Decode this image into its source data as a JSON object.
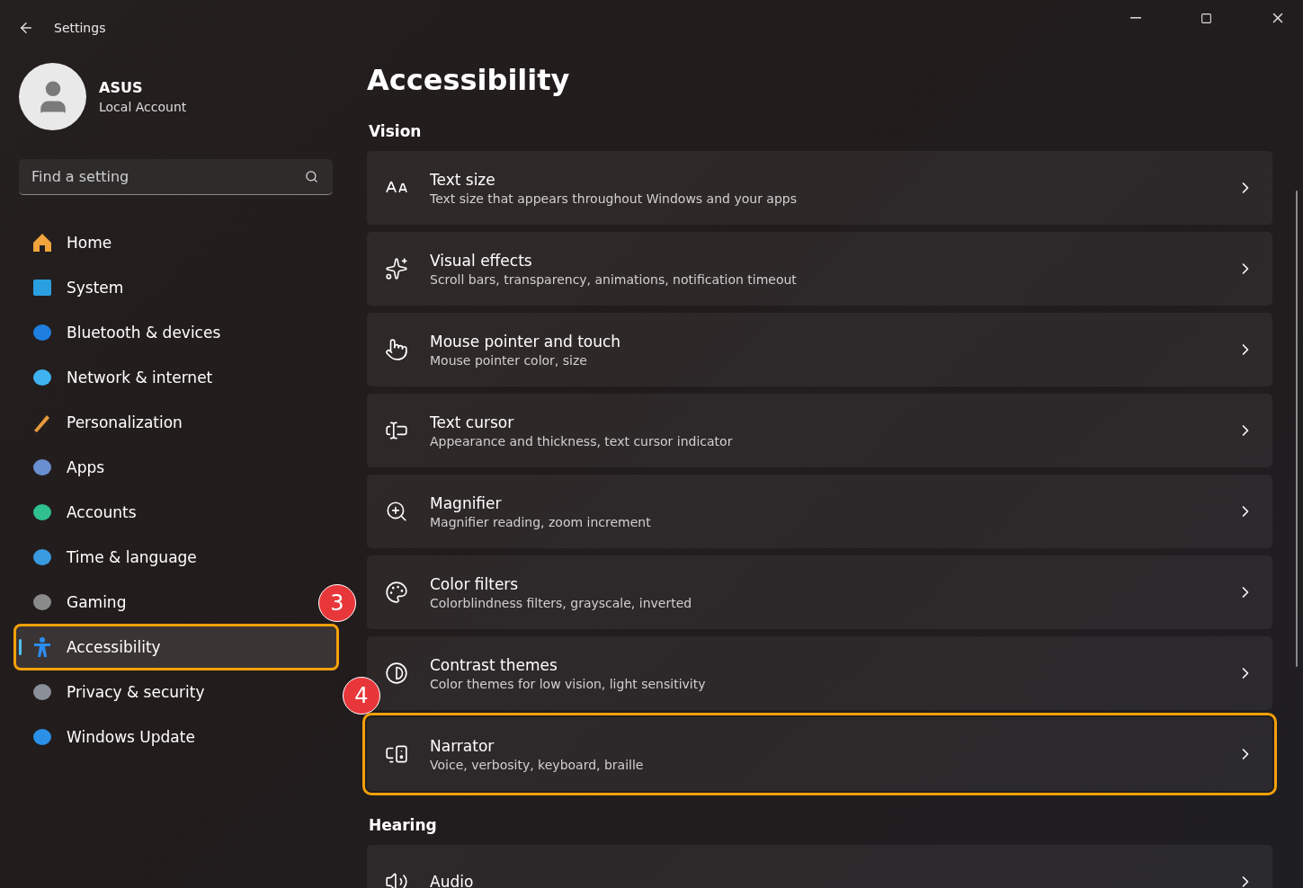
{
  "window": {
    "title": "Settings"
  },
  "account": {
    "name": "ASUS",
    "type": "Local Account"
  },
  "search": {
    "placeholder": "Find a setting"
  },
  "nav_items": [
    {
      "label": "Home",
      "selected": false
    },
    {
      "label": "System",
      "selected": false
    },
    {
      "label": "Bluetooth & devices",
      "selected": false
    },
    {
      "label": "Network & internet",
      "selected": false
    },
    {
      "label": "Personalization",
      "selected": false
    },
    {
      "label": "Apps",
      "selected": false
    },
    {
      "label": "Accounts",
      "selected": false
    },
    {
      "label": "Time & language",
      "selected": false
    },
    {
      "label": "Gaming",
      "selected": false
    },
    {
      "label": "Accessibility",
      "selected": true,
      "callout": "3"
    },
    {
      "label": "Privacy & security",
      "selected": false
    },
    {
      "label": "Windows Update",
      "selected": false
    }
  ],
  "page_title": "Accessibility",
  "sections": [
    {
      "title": "Vision",
      "items": [
        {
          "title": "Text size",
          "subtitle": "Text size that appears throughout Windows and your apps"
        },
        {
          "title": "Visual effects",
          "subtitle": "Scroll bars, transparency, animations, notification timeout"
        },
        {
          "title": "Mouse pointer and touch",
          "subtitle": "Mouse pointer color, size"
        },
        {
          "title": "Text cursor",
          "subtitle": "Appearance and thickness, text cursor indicator"
        },
        {
          "title": "Magnifier",
          "subtitle": "Magnifier reading, zoom increment"
        },
        {
          "title": "Color filters",
          "subtitle": "Colorblindness filters, grayscale, inverted"
        },
        {
          "title": "Contrast themes",
          "subtitle": "Color themes for low vision, light sensitivity"
        },
        {
          "title": "Narrator",
          "subtitle": "Voice, verbosity, keyboard, braille",
          "callout": "4"
        }
      ]
    },
    {
      "title": "Hearing",
      "items": [
        {
          "title": "Audio"
        }
      ]
    }
  ]
}
